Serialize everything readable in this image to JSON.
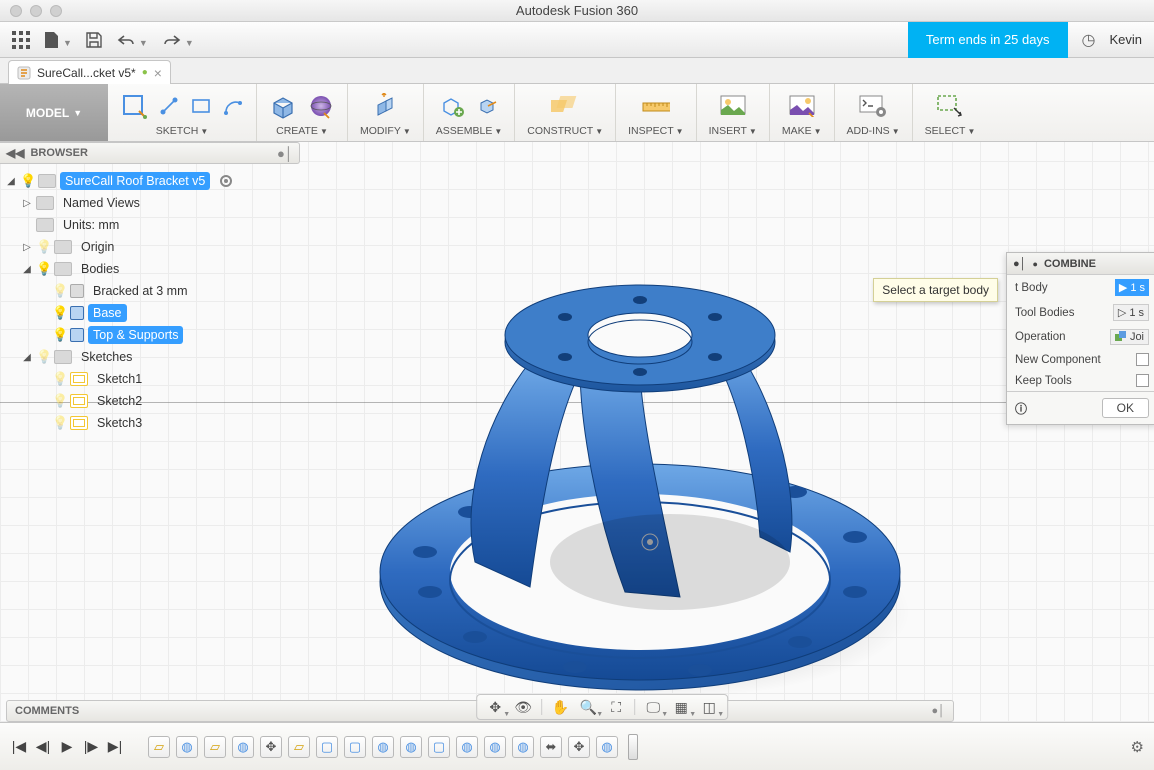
{
  "app_title": "Autodesk Fusion 360",
  "banner": "Term ends in 25 days",
  "username": "Kevin",
  "tab": {
    "label": "SureCall...cket v5*",
    "dirty": true
  },
  "workspace_button": "MODEL",
  "ribbon": {
    "groups": [
      {
        "label": "SKETCH",
        "has_dropdown": true
      },
      {
        "label": "CREATE",
        "has_dropdown": true
      },
      {
        "label": "MODIFY",
        "has_dropdown": true
      },
      {
        "label": "ASSEMBLE",
        "has_dropdown": true
      },
      {
        "label": "CONSTRUCT",
        "has_dropdown": true
      },
      {
        "label": "INSPECT",
        "has_dropdown": true
      },
      {
        "label": "INSERT",
        "has_dropdown": true
      },
      {
        "label": "MAKE",
        "has_dropdown": true
      },
      {
        "label": "ADD-INS",
        "has_dropdown": true
      },
      {
        "label": "SELECT",
        "has_dropdown": true
      }
    ]
  },
  "browser": {
    "title": "BROWSER",
    "root": "SureCall Roof Bracket v5",
    "items": {
      "named_views": "Named Views",
      "units": "Units: mm",
      "origin": "Origin",
      "bodies": "Bodies",
      "body1": "Bracked at 3 mm",
      "body2": "Base",
      "body3": "Top & Supports",
      "sketches": "Sketches",
      "sketch1": "Sketch1",
      "sketch2": "Sketch2",
      "sketch3": "Sketch3"
    }
  },
  "combine": {
    "title": "COMBINE",
    "tooltip": "Select a target body",
    "rows": {
      "target_label_suffix": "t Body",
      "target_value": "1 s",
      "tool_label": "Tool Bodies",
      "tool_value": "1 s",
      "operation_label": "Operation",
      "operation_value": "Joi",
      "newcomp_label": "New Component",
      "keep_label": "Keep Tools"
    },
    "ok": "OK"
  },
  "comments_title": "COMMENTS"
}
